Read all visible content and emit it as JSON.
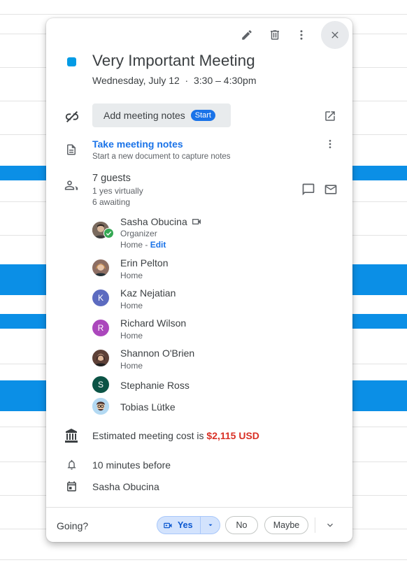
{
  "event": {
    "title": "Very Important Meeting",
    "datetime": "Wednesday, July 12  ·  3:30 – 4:30pm",
    "color": "#039be5"
  },
  "toolbar": {
    "edit_icon": "pencil-icon",
    "delete_icon": "trash-icon",
    "more_icon": "more-vert-icon",
    "close_icon": "close-icon"
  },
  "meeting_notes": {
    "button_label": "Add meeting notes",
    "start_badge": "Start",
    "take_notes_link": "Take meeting notes",
    "take_notes_sub": "Start a new document to capture notes"
  },
  "guests": {
    "summary": "7 guests",
    "yes_line": "1 yes virtually",
    "awaiting_line": "6 awaiting",
    "list": [
      {
        "name": "Sasha Obucina",
        "role": "Organizer",
        "location": "Home",
        "edit": "Edit",
        "avatar": "photo",
        "status": "accepted"
      },
      {
        "name": "Erin Pelton",
        "location": "Home",
        "avatar": "photo"
      },
      {
        "name": "Kaz Nejatian",
        "location": "Home",
        "avatar": "K",
        "color": "#5c6bc0"
      },
      {
        "name": "Richard Wilson",
        "location": "Home",
        "avatar": "R",
        "color": "#ab47bc"
      },
      {
        "name": "Shannon O'Brien",
        "location": "Home",
        "avatar": "photo"
      },
      {
        "name": "Stephanie Ross",
        "avatar": "S",
        "color": "#0b5345"
      },
      {
        "name": "Tobias Lütke",
        "avatar": "photo"
      }
    ]
  },
  "cost": {
    "label": "Estimated meeting cost is ",
    "value": "$2,115 USD",
    "value_color": "#d93025"
  },
  "reminder": "10 minutes before",
  "calendar_owner": "Sasha Obucina",
  "footer": {
    "going_label": "Going?",
    "yes": "Yes",
    "no": "No",
    "maybe": "Maybe"
  },
  "colors": {
    "accent": "#1a73e8",
    "background_band": "#0b8fe6"
  }
}
